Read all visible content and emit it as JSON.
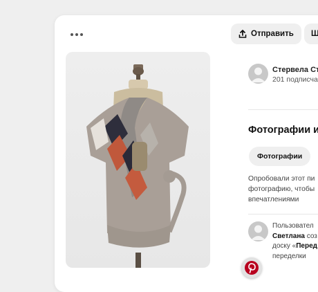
{
  "toolbar": {
    "more_icon": "more-horizontal-icon",
    "share_label": "Отправить",
    "share_icon": "upload-icon",
    "save_label": "Ш"
  },
  "author": {
    "name": "Стервела Сто",
    "subscribers": "201 подписча",
    "avatar_icon": "user-avatar-icon"
  },
  "photos_section": {
    "title": "Фотографии и",
    "chip_label": "Фотографии",
    "prompt_lines": [
      "Опробовали этот пи",
      "фотографию, чтобы",
      "впечатлениями"
    ]
  },
  "activity": {
    "line1": "Пользовател",
    "user": "Светлана",
    "line2_rest": " соз",
    "line3_prefix": "доску «",
    "board": "Перед",
    "line4": "переделки"
  },
  "colors": {
    "background": "#efefef",
    "card": "#ffffff",
    "button": "#efefef",
    "pin_badge": "#b8001f"
  }
}
